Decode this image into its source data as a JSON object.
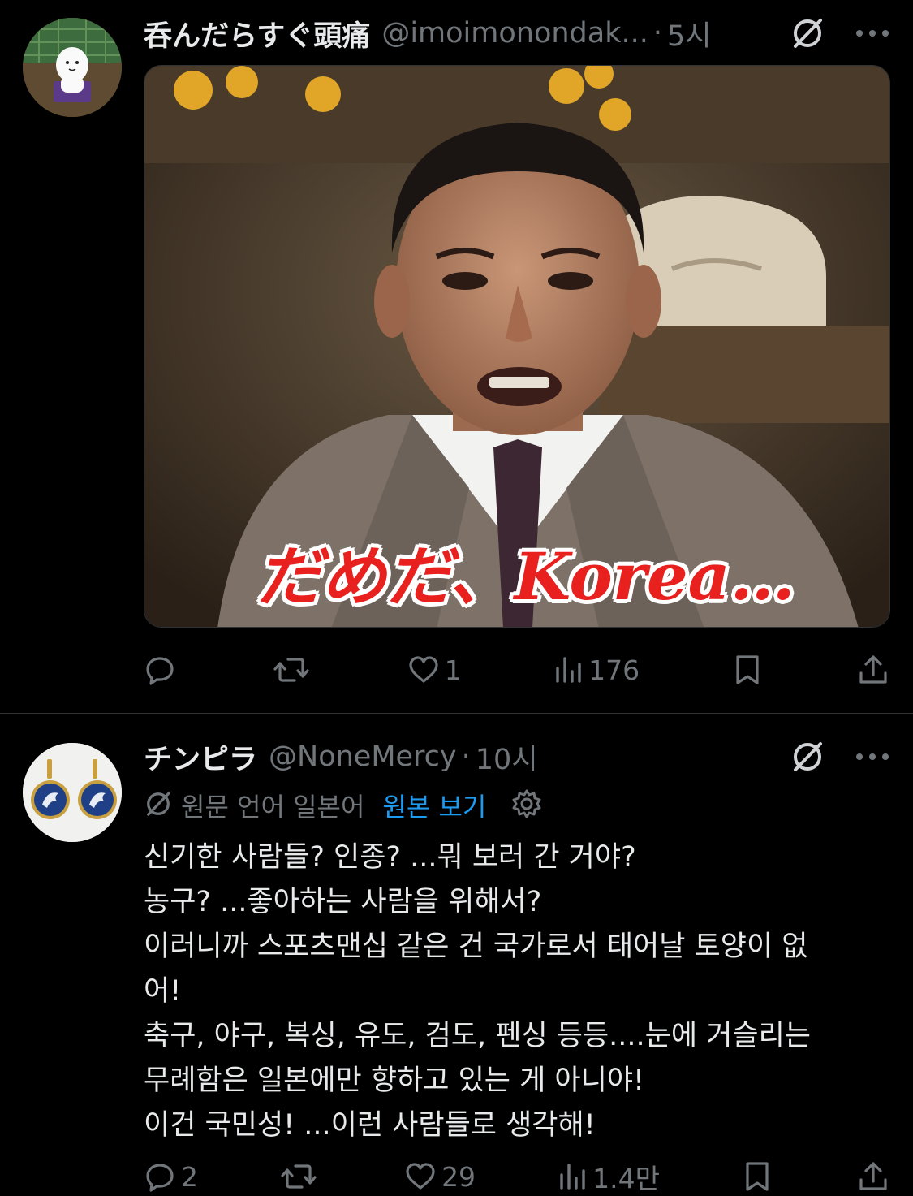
{
  "tweets": [
    {
      "display_name": "呑んだらすぐ頭痛",
      "handle": "@imoimonondak...",
      "time": "5시",
      "media": {
        "subtitle": "だめだ、Korea…"
      },
      "actions": {
        "reply": "",
        "retweet": "",
        "like": "1",
        "views": "176"
      }
    },
    {
      "display_name": "チンピラ",
      "handle": "@NoneMercy",
      "time": "10시",
      "translation": {
        "text": "원문 언어 일본어",
        "link": "원본 보기"
      },
      "body_lines": [
        "신기한 사람들? 인종? ...뭐 보러 간 거야?",
        "농구? ...좋아하는 사람을 위해서?",
        "이러니까 스포츠맨십 같은 건 국가로서 태어날 토양이 없",
        "어!",
        "축구, 야구, 복싱, 유도, 검도, 펜싱 등등....눈에 거슬리는",
        "무례함은 일본에만 향하고 있는 게 아니야!",
        "이건 국민성! ...이런 사람들로 생각해!"
      ],
      "actions": {
        "reply": "2",
        "retweet": "",
        "like": "29",
        "views": "1.4만"
      }
    }
  ],
  "colors": {
    "background": "#000000",
    "text": "#e7e9ea",
    "muted": "#71767b",
    "link": "#1d9bf0",
    "subtitle": "#e8201e"
  },
  "icons": [
    "grok-icon",
    "more-icon",
    "reply-icon",
    "retweet-icon",
    "like-icon",
    "views-icon",
    "bookmark-icon",
    "share-icon",
    "translate-icon",
    "settings-icon"
  ]
}
